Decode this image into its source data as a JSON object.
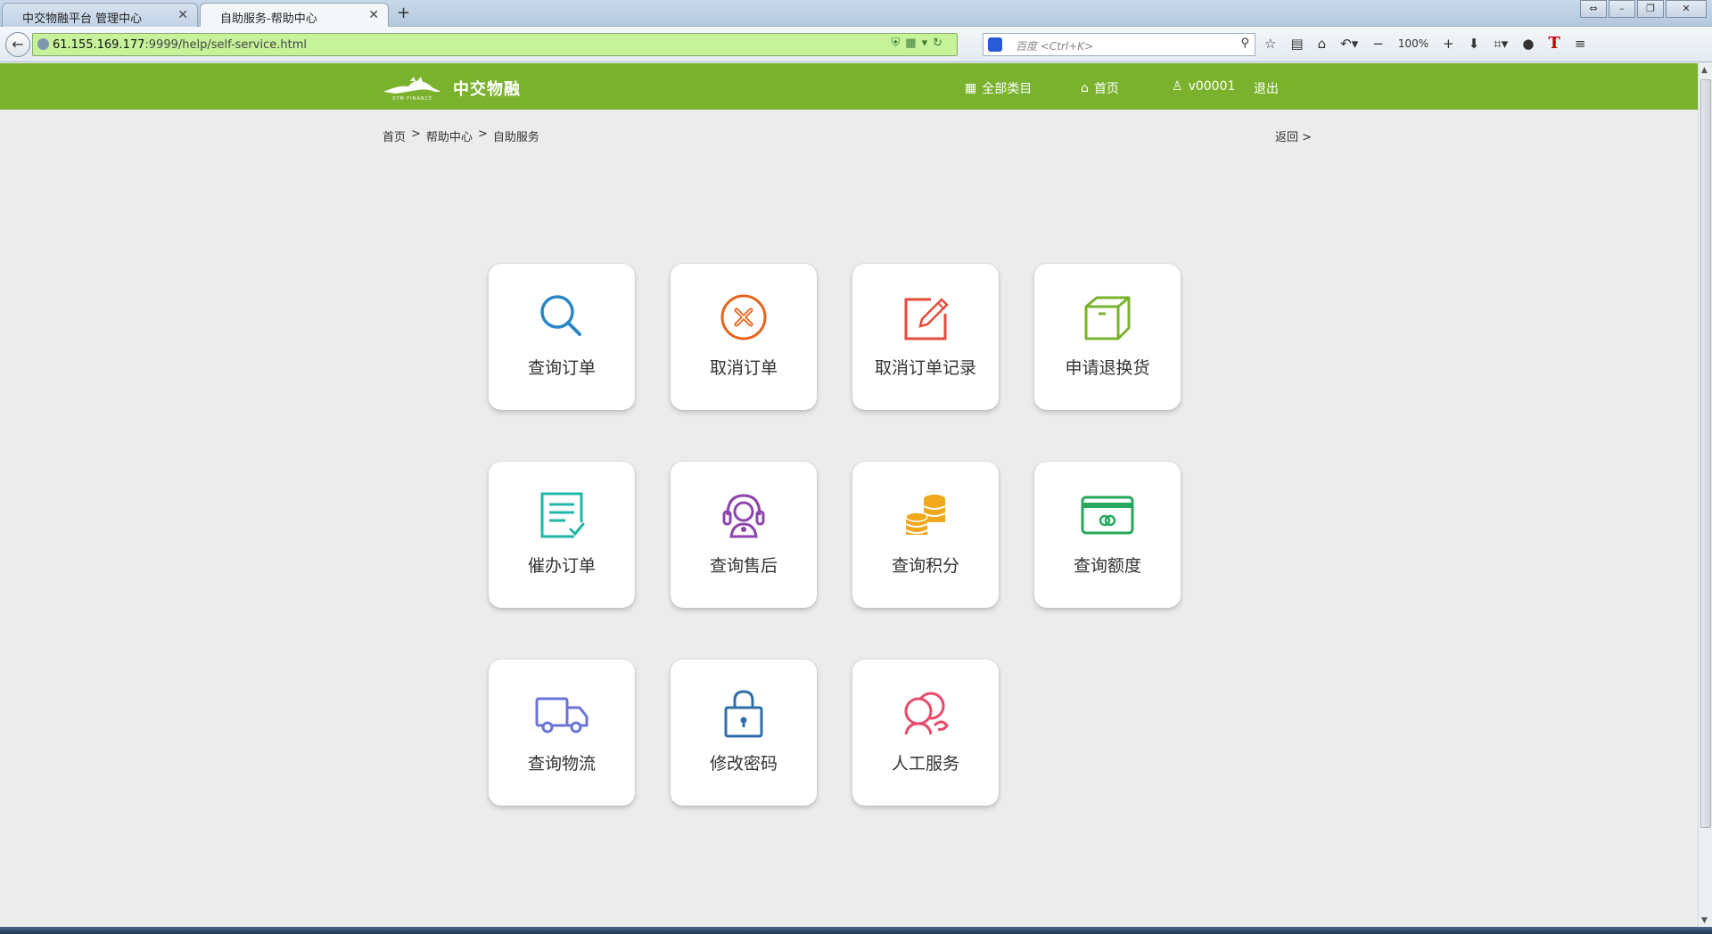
{
  "browser": {
    "tabs": [
      {
        "title": "中交物融平台 管理中心",
        "active": false
      },
      {
        "title": "自助服务-帮助中心",
        "active": true
      }
    ],
    "url_host": "61.155.169.177",
    "url_rest": ":9999/help/self-service.html",
    "search_placeholder": "百度 <Ctrl+K>",
    "zoom": "100%"
  },
  "header": {
    "brand": "中交物融",
    "brand_sub": "XTM FINANCE",
    "nav": {
      "categories": "全部类目",
      "home": "首页",
      "user": "v00001",
      "logout": "退出"
    }
  },
  "breadcrumb": {
    "items": [
      "首页",
      ">",
      "帮助中心",
      ">",
      "自助服务"
    ],
    "back": "返回 >"
  },
  "tiles": [
    {
      "label": "查询订单",
      "icon": "search-icon",
      "color": "#2b86c5"
    },
    {
      "label": "取消订单",
      "icon": "cancel-circle-icon",
      "color": "#e8641c"
    },
    {
      "label": "取消订单记录",
      "icon": "edit-icon",
      "color": "#e64b3c"
    },
    {
      "label": "申请退换货",
      "icon": "box-icon",
      "color": "#7ab22e"
    },
    {
      "label": "催办订单",
      "icon": "checklist-icon",
      "color": "#1fb7a7"
    },
    {
      "label": "查询售后",
      "icon": "headset-icon",
      "color": "#8e44ad"
    },
    {
      "label": "查询积分",
      "icon": "coins-icon",
      "color": "#f0a81c"
    },
    {
      "label": "查询额度",
      "icon": "card-icon",
      "color": "#27a85c"
    },
    {
      "label": "查询物流",
      "icon": "truck-icon",
      "color": "#6a73d8"
    },
    {
      "label": "修改密码",
      "icon": "lock-icon",
      "color": "#2f6fa8"
    },
    {
      "label": "人工服务",
      "icon": "customer-service-icon",
      "color": "#e94a6a"
    }
  ]
}
